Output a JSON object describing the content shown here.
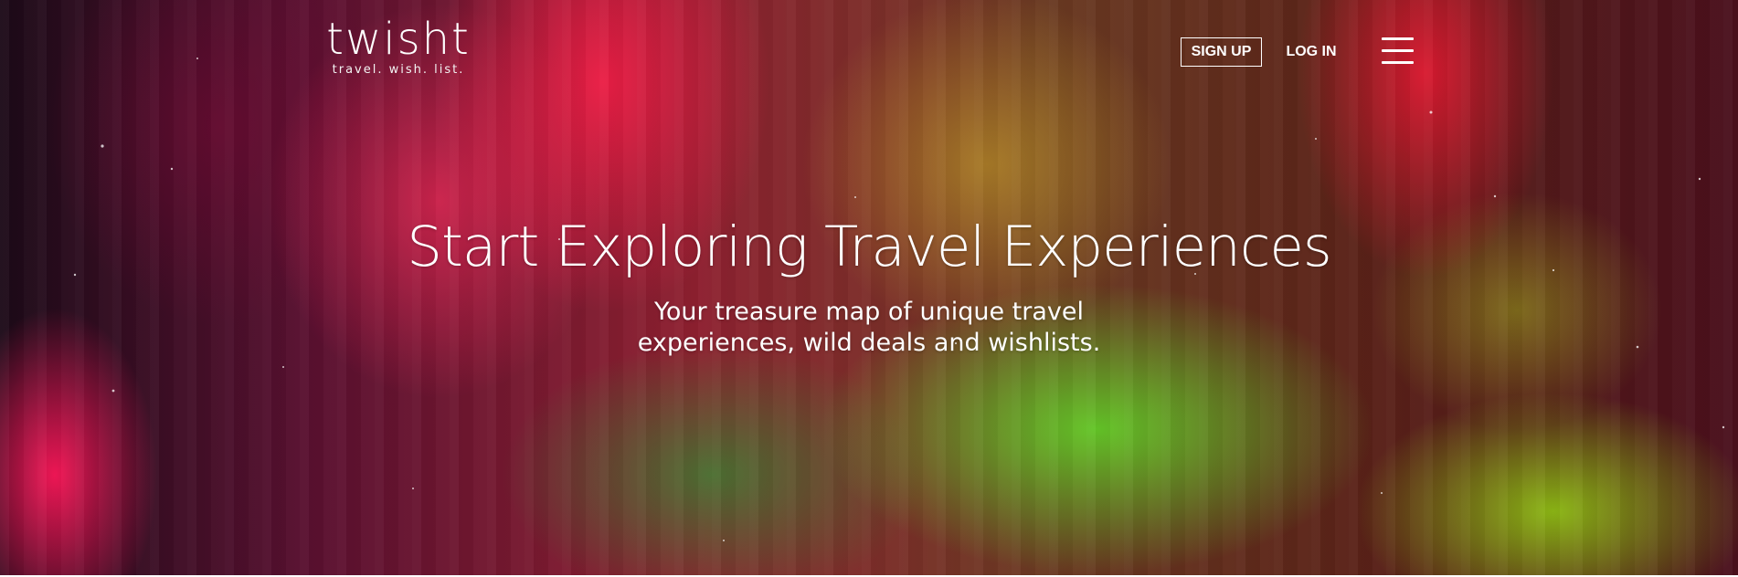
{
  "header": {
    "logo": {
      "wordmark": "twisht",
      "tagline": "travel. wish. list."
    },
    "signup_label": "SIGN UP",
    "login_label": "LOG IN",
    "menu_icon": "hamburger-menu-icon"
  },
  "hero": {
    "headline": "Start Exploring Travel Experiences",
    "subheadline": "Your treasure map of unique travel experiences, wild deals and wishlists.",
    "background": "aurora-borealis-photo"
  },
  "colors": {
    "text": "#ffffff",
    "aurora_pink": "#ff185a",
    "aurora_green": "#64cd28",
    "sky_dark": "#1c0a18"
  }
}
